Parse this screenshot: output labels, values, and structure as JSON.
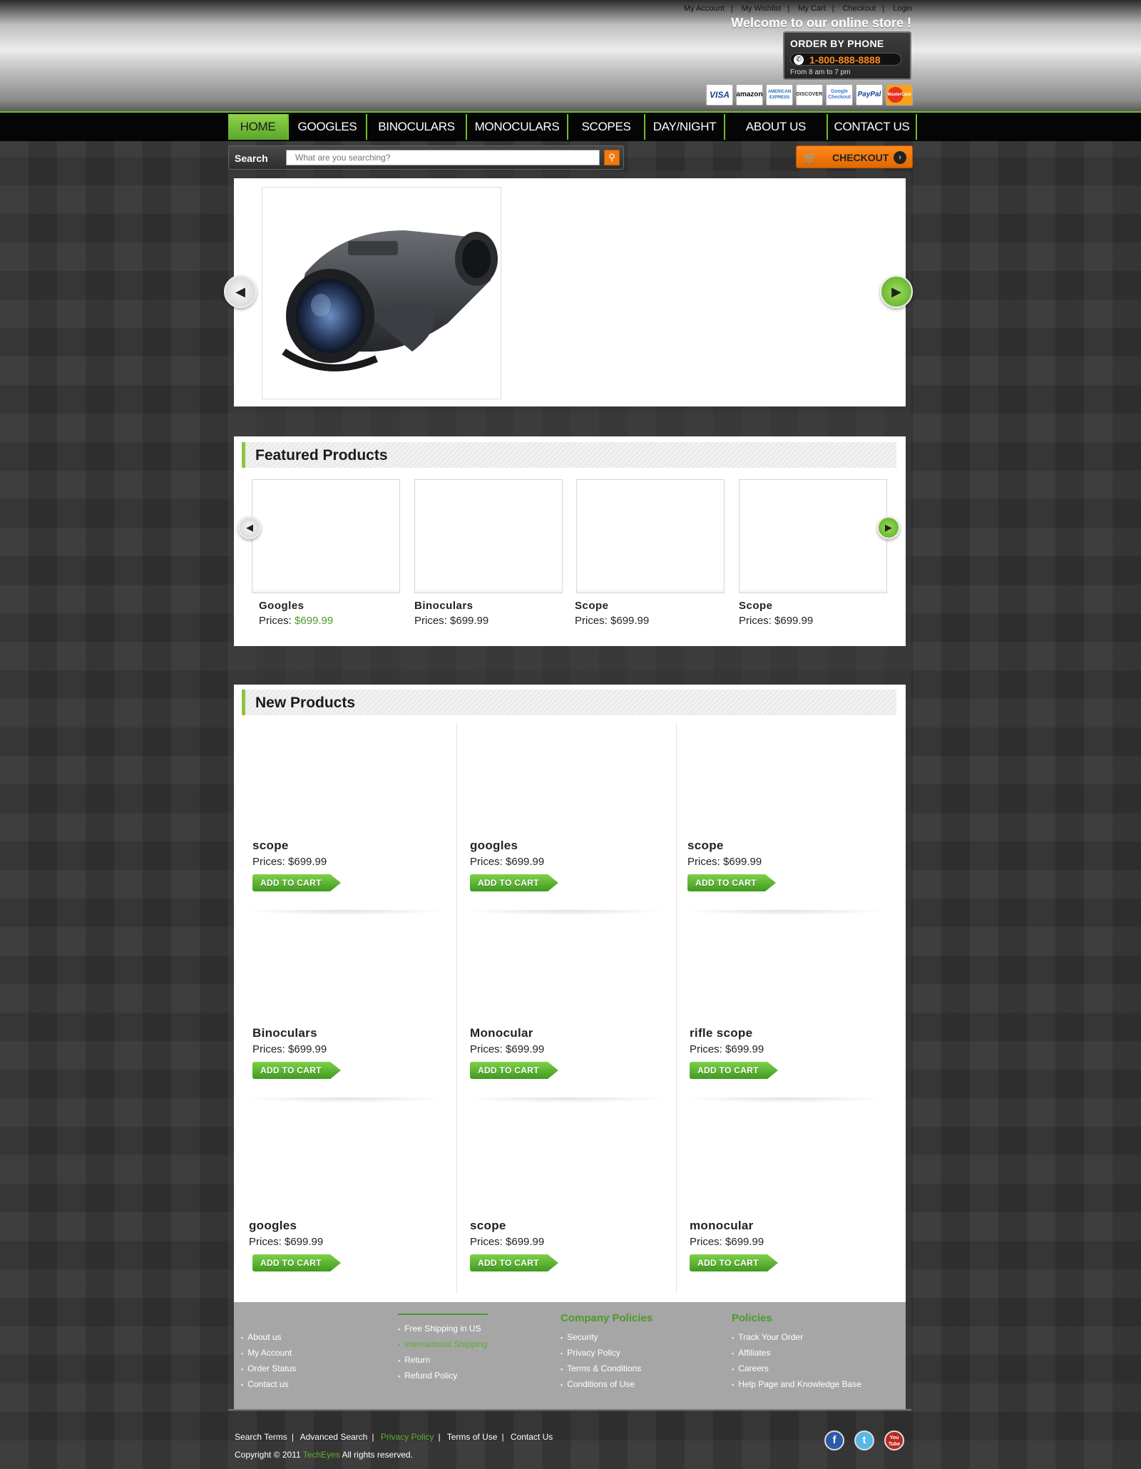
{
  "header": {
    "top_links": [
      "My Account",
      "My Wishlist",
      "My Cart",
      "Checkout",
      "Login"
    ],
    "welcome": "Welcome to our online store !",
    "phone": {
      "title": "ORDER BY PHONE",
      "number": "1-800-888-8888",
      "hours": "From 8 am to 7 pm"
    },
    "payment_cards": [
      "VISA",
      "amazon",
      "AMERICAN EXPRESS",
      "DISCOVER",
      "Google Checkout",
      "PayPal",
      "MasterCard"
    ]
  },
  "nav": {
    "items": [
      "HOME",
      "GOOGLES",
      "BINOCULARS",
      "MONOCULARS",
      "SCOPES",
      "DAY/NIGHT",
      "ABOUT US",
      "CONTACT US"
    ],
    "active": "HOME"
  },
  "search": {
    "label": "Search",
    "placeholder": "What are you searching?"
  },
  "checkout": {
    "label": "CHECKOUT"
  },
  "featured": {
    "title": "Featured Products",
    "price_label": "Prices:",
    "items": [
      {
        "name": "Googles",
        "price": "$699.99"
      },
      {
        "name": "Binoculars",
        "price": "$699.99"
      },
      {
        "name": "Scope",
        "price": "$699.99"
      },
      {
        "name": "Scope",
        "price": "$699.99"
      }
    ]
  },
  "new_products": {
    "title": "New Products",
    "price_label": "Prices:",
    "add_label": "ADD TO CART",
    "items": [
      {
        "name": "scope",
        "price": "$699.99"
      },
      {
        "name": "googles",
        "price": "$699.99"
      },
      {
        "name": "scope",
        "price": "$699.99"
      },
      {
        "name": "Binoculars",
        "price": "$699.99"
      },
      {
        "name": "Monocular",
        "price": "$699.99"
      },
      {
        "name": "rifle scope",
        "price": "$699.99"
      },
      {
        "name": "googles",
        "price": "$699.99"
      },
      {
        "name": "scope",
        "price": "$699.99"
      },
      {
        "name": "monocular",
        "price": "$699.99"
      }
    ]
  },
  "footer": {
    "col1": {
      "items": [
        "About us",
        "My Account",
        "Order Status",
        "Contact us"
      ]
    },
    "col2": {
      "items": [
        "Free Shipping in US",
        "International Shipping",
        "Return",
        "Refund Policy"
      ]
    },
    "col3": {
      "title": "Company Policies",
      "items": [
        "Security",
        "Privacy Policy",
        "Terms & Conditions",
        "Conditions of Use"
      ]
    },
    "col4": {
      "title": "Policies",
      "items": [
        "Track Your Order",
        "Affiliates",
        "Careers",
        "Help Page and Knowledge Base"
      ]
    }
  },
  "bottom": {
    "links": [
      "Search Terms",
      "Advanced Search",
      "Privacy Policy",
      "Terms of Use",
      "Contact Us"
    ],
    "copyright_prefix": "Copyright © 2011",
    "brand": "TechEyes",
    "copyright_suffix": "All rights reserved."
  },
  "social": [
    "f",
    "t",
    "You Tube"
  ],
  "colors": {
    "accent_green": "#6fbf2b",
    "price_green": "#4c9a2a",
    "orange": "#f07a10"
  }
}
